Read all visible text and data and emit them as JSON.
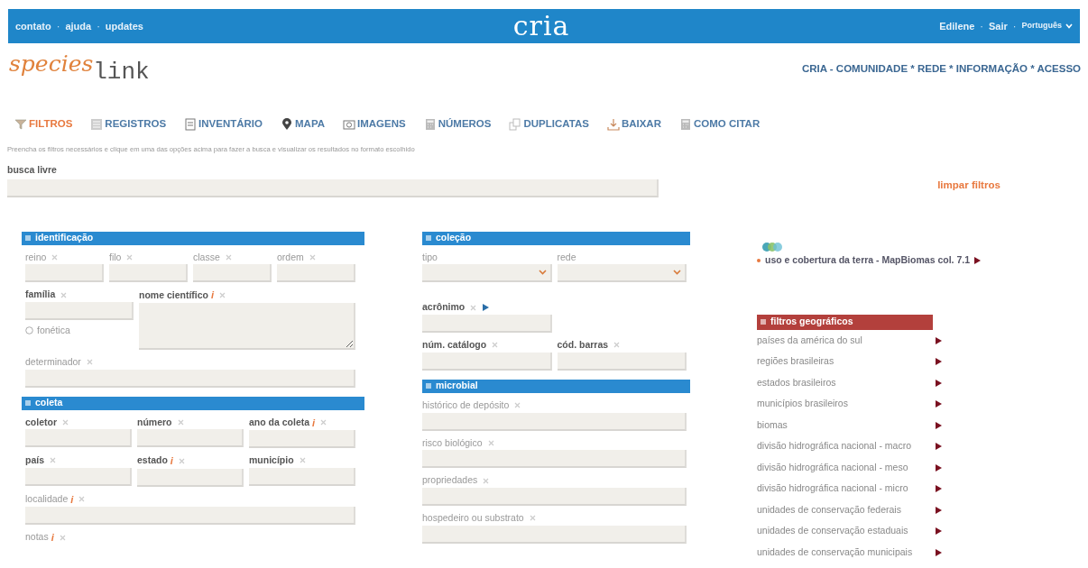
{
  "top_bar": {
    "left_links": [
      "contato",
      "ajuda",
      "updates"
    ],
    "separator": "·",
    "brand": "cria",
    "right_links": [
      {
        "label": "Edilene",
        "kind": "link"
      },
      {
        "label": "Sair",
        "kind": "link"
      },
      {
        "label": "Português",
        "kind": "dropdown"
      }
    ]
  },
  "logo": {
    "part1": "species",
    "part2": "link"
  },
  "site_links": "CRIA - COMUNIDADE * REDE * INFORMAÇÃO * ACESSO",
  "tabs": [
    {
      "label": "FILTROS",
      "selected": true
    },
    {
      "label": "REGISTROS",
      "selected": false
    },
    {
      "label": "INVENTÁRIO",
      "selected": false
    },
    {
      "label": "MAPA",
      "selected": false
    },
    {
      "label": "IMAGENS",
      "selected": false
    },
    {
      "label": "NÚMEROS",
      "selected": false
    },
    {
      "label": "DUPLICATAS",
      "selected": false
    },
    {
      "label": "BAIXAR",
      "selected": false
    },
    {
      "label": "COMO CITAR",
      "selected": false
    }
  ],
  "instructions": "Preencha os filtros necessários e clique em uma das opções acima para fazer a busca e visualizar os resultados no formato escolhido",
  "search": {
    "label": "busca livre"
  },
  "clear_button": "limpar filtros",
  "columns": [
    [
      {
        "title": "identificação",
        "color": "#2a8ad0",
        "groups": [
          {
            "fields": [
              {
                "label": "reino",
                "kind": "text",
                "strong": false,
                "clear_mark": true
              },
              {
                "label": "filo",
                "kind": "text",
                "strong": false,
                "clear_mark": true
              },
              {
                "label": "classe",
                "kind": "text",
                "strong": false,
                "clear_mark": true
              },
              {
                "label": "ordem",
                "kind": "text",
                "strong": false,
                "clear_mark": true
              }
            ]
          },
          {
            "fields": [
              {
                "label": "família",
                "kind": "text",
                "strong": true,
                "clear_mark": true,
                "option": {
                  "label": "fonética",
                  "checked": false
                }
              },
              {
                "label": "nome científico",
                "kind": "textarea",
                "strong": true,
                "info": "i",
                "clear_mark": true
              }
            ]
          },
          {
            "fields": [
              {
                "label": "determinador",
                "kind": "text",
                "strong": false,
                "clear_mark": true
              }
            ]
          }
        ]
      },
      {
        "title": "coleta",
        "color": "#2a8ad0",
        "groups": [
          {
            "fields": [
              {
                "label": "coletor",
                "kind": "text",
                "strong": true,
                "clear_mark": true
              },
              {
                "label": "número",
                "kind": "text",
                "strong": true,
                "clear_mark": true
              },
              {
                "label": "ano da coleta",
                "kind": "text",
                "strong": true,
                "info": "i",
                "clear_mark": true
              }
            ]
          },
          {
            "fields": [
              {
                "label": "país",
                "kind": "text",
                "strong": true,
                "clear_mark": true
              },
              {
                "label": "estado",
                "kind": "text",
                "strong": true,
                "info": "i",
                "clear_mark": true
              },
              {
                "label": "município",
                "kind": "text",
                "strong": true,
                "clear_mark": true
              }
            ]
          },
          {
            "fields": [
              {
                "label": "localidade",
                "kind": "text",
                "strong": false,
                "info": "i",
                "clear_mark": true
              }
            ]
          },
          {
            "fields": [
              {
                "label": "notas",
                "kind": "label",
                "strong": false,
                "info": "i",
                "clear_mark": true
              }
            ]
          }
        ]
      }
    ],
    [
      {
        "title": "coleção",
        "color": "#2a8ad0",
        "groups": [
          {
            "fields": [
              {
                "label": "tipo",
                "kind": "select",
                "strong": false
              },
              {
                "label": "rede",
                "kind": "select",
                "strong": false
              }
            ]
          },
          {
            "fields": [
              {
                "label": "acrônimo",
                "kind": "text",
                "strong": true,
                "clear_mark": true,
                "arrow": true
              }
            ]
          },
          {
            "fields": [
              {
                "label": "núm. catálogo",
                "kind": "text",
                "strong": true,
                "clear_mark": true
              },
              {
                "label": "cód. barras",
                "kind": "text",
                "strong": true,
                "clear_mark": true
              }
            ]
          }
        ]
      },
      {
        "title": "microbial",
        "color": "#2a8ad0",
        "groups": [
          {
            "fields": [
              {
                "label": "histórico de depósito",
                "kind": "text",
                "strong": false,
                "clear_mark": true
              }
            ]
          },
          {
            "fields": [
              {
                "label": "risco biológico",
                "kind": "text",
                "strong": false,
                "clear_mark": true
              }
            ]
          },
          {
            "fields": [
              {
                "label": "propriedades",
                "kind": "text",
                "strong": false,
                "clear_mark": true
              }
            ]
          },
          {
            "fields": [
              {
                "label": "hospedeiro ou substrato",
                "kind": "text",
                "strong": false,
                "clear_mark": true
              }
            ]
          }
        ]
      }
    ]
  ],
  "mapbiomas": {
    "item": "uso e cobertura da terra - MapBiomas col. 7.1"
  },
  "geo_filters": {
    "title": "filtros geográficos",
    "color": "#b3403c",
    "items": [
      "países da américa do sul",
      "regiões brasileiras",
      "estados brasileiros",
      "municípios brasileiros",
      "biomas",
      "divisão hidrográfica nacional - macro",
      "divisão hidrográfica nacional - meso",
      "divisão hidrográfica nacional - micro",
      "unidades de conservação federais",
      "unidades de conservação estaduais",
      "unidades de conservação municipais"
    ]
  }
}
